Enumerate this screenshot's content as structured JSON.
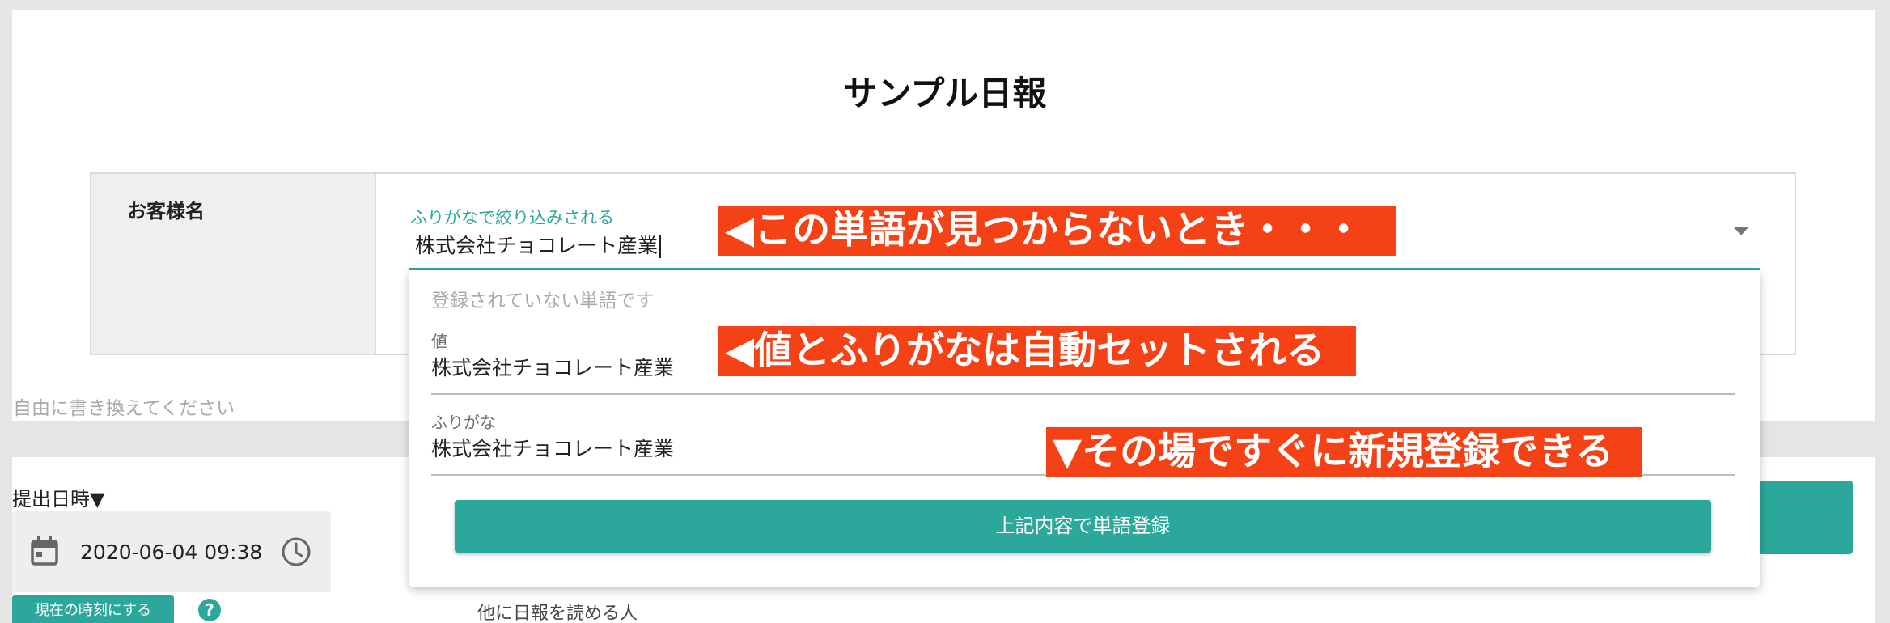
{
  "page": {
    "title": "サンプル日報"
  },
  "customer": {
    "label": "お客様名",
    "hint": "ふりがなで絞り込みされる",
    "value": "株式会社チョコレート産業"
  },
  "hint_bottom": "自由に書き換えてください",
  "popup": {
    "notice": "登録されていない単語です",
    "value_label": "値",
    "value": "株式会社チョコレート産業",
    "furigana_label": "ふりがな",
    "furigana": "株式会社チョコレート産業",
    "register_button": "上記内容で単語登録"
  },
  "submission": {
    "label": "提出日時▼",
    "datetime": "2020-06-04 09:38",
    "now_button": "現在の時刻にする",
    "help": "?"
  },
  "readers_label": "他に日報を読める人",
  "annotations": {
    "a1": "◀この単語が見つからないとき・・・",
    "a2": "◀値とふりがなは自動セットされる",
    "a3": "▼その場ですぐに新規登録できる"
  },
  "colors": {
    "accent": "#2ba89b",
    "annotation": "#f44115"
  },
  "icons": [
    "calendar-icon",
    "clock-icon",
    "chevron-down-icon",
    "help-icon"
  ]
}
